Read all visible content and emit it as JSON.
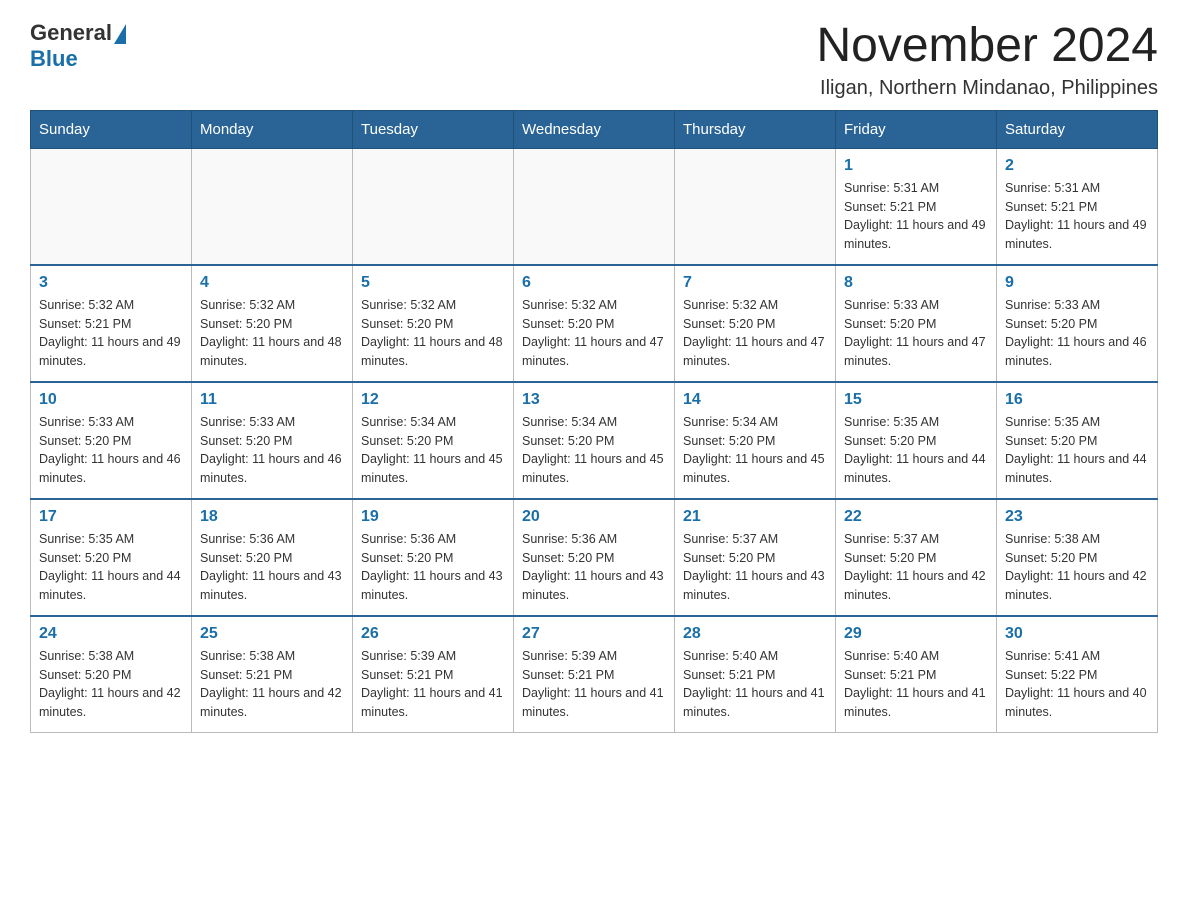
{
  "header": {
    "logo_general": "General",
    "logo_blue": "Blue",
    "month_title": "November 2024",
    "location": "Iligan, Northern Mindanao, Philippines"
  },
  "weekdays": [
    "Sunday",
    "Monday",
    "Tuesday",
    "Wednesday",
    "Thursday",
    "Friday",
    "Saturday"
  ],
  "weeks": [
    [
      {
        "day": "",
        "info": ""
      },
      {
        "day": "",
        "info": ""
      },
      {
        "day": "",
        "info": ""
      },
      {
        "day": "",
        "info": ""
      },
      {
        "day": "",
        "info": ""
      },
      {
        "day": "1",
        "info": "Sunrise: 5:31 AM\nSunset: 5:21 PM\nDaylight: 11 hours and 49 minutes."
      },
      {
        "day": "2",
        "info": "Sunrise: 5:31 AM\nSunset: 5:21 PM\nDaylight: 11 hours and 49 minutes."
      }
    ],
    [
      {
        "day": "3",
        "info": "Sunrise: 5:32 AM\nSunset: 5:21 PM\nDaylight: 11 hours and 49 minutes."
      },
      {
        "day": "4",
        "info": "Sunrise: 5:32 AM\nSunset: 5:20 PM\nDaylight: 11 hours and 48 minutes."
      },
      {
        "day": "5",
        "info": "Sunrise: 5:32 AM\nSunset: 5:20 PM\nDaylight: 11 hours and 48 minutes."
      },
      {
        "day": "6",
        "info": "Sunrise: 5:32 AM\nSunset: 5:20 PM\nDaylight: 11 hours and 47 minutes."
      },
      {
        "day": "7",
        "info": "Sunrise: 5:32 AM\nSunset: 5:20 PM\nDaylight: 11 hours and 47 minutes."
      },
      {
        "day": "8",
        "info": "Sunrise: 5:33 AM\nSunset: 5:20 PM\nDaylight: 11 hours and 47 minutes."
      },
      {
        "day": "9",
        "info": "Sunrise: 5:33 AM\nSunset: 5:20 PM\nDaylight: 11 hours and 46 minutes."
      }
    ],
    [
      {
        "day": "10",
        "info": "Sunrise: 5:33 AM\nSunset: 5:20 PM\nDaylight: 11 hours and 46 minutes."
      },
      {
        "day": "11",
        "info": "Sunrise: 5:33 AM\nSunset: 5:20 PM\nDaylight: 11 hours and 46 minutes."
      },
      {
        "day": "12",
        "info": "Sunrise: 5:34 AM\nSunset: 5:20 PM\nDaylight: 11 hours and 45 minutes."
      },
      {
        "day": "13",
        "info": "Sunrise: 5:34 AM\nSunset: 5:20 PM\nDaylight: 11 hours and 45 minutes."
      },
      {
        "day": "14",
        "info": "Sunrise: 5:34 AM\nSunset: 5:20 PM\nDaylight: 11 hours and 45 minutes."
      },
      {
        "day": "15",
        "info": "Sunrise: 5:35 AM\nSunset: 5:20 PM\nDaylight: 11 hours and 44 minutes."
      },
      {
        "day": "16",
        "info": "Sunrise: 5:35 AM\nSunset: 5:20 PM\nDaylight: 11 hours and 44 minutes."
      }
    ],
    [
      {
        "day": "17",
        "info": "Sunrise: 5:35 AM\nSunset: 5:20 PM\nDaylight: 11 hours and 44 minutes."
      },
      {
        "day": "18",
        "info": "Sunrise: 5:36 AM\nSunset: 5:20 PM\nDaylight: 11 hours and 43 minutes."
      },
      {
        "day": "19",
        "info": "Sunrise: 5:36 AM\nSunset: 5:20 PM\nDaylight: 11 hours and 43 minutes."
      },
      {
        "day": "20",
        "info": "Sunrise: 5:36 AM\nSunset: 5:20 PM\nDaylight: 11 hours and 43 minutes."
      },
      {
        "day": "21",
        "info": "Sunrise: 5:37 AM\nSunset: 5:20 PM\nDaylight: 11 hours and 43 minutes."
      },
      {
        "day": "22",
        "info": "Sunrise: 5:37 AM\nSunset: 5:20 PM\nDaylight: 11 hours and 42 minutes."
      },
      {
        "day": "23",
        "info": "Sunrise: 5:38 AM\nSunset: 5:20 PM\nDaylight: 11 hours and 42 minutes."
      }
    ],
    [
      {
        "day": "24",
        "info": "Sunrise: 5:38 AM\nSunset: 5:20 PM\nDaylight: 11 hours and 42 minutes."
      },
      {
        "day": "25",
        "info": "Sunrise: 5:38 AM\nSunset: 5:21 PM\nDaylight: 11 hours and 42 minutes."
      },
      {
        "day": "26",
        "info": "Sunrise: 5:39 AM\nSunset: 5:21 PM\nDaylight: 11 hours and 41 minutes."
      },
      {
        "day": "27",
        "info": "Sunrise: 5:39 AM\nSunset: 5:21 PM\nDaylight: 11 hours and 41 minutes."
      },
      {
        "day": "28",
        "info": "Sunrise: 5:40 AM\nSunset: 5:21 PM\nDaylight: 11 hours and 41 minutes."
      },
      {
        "day": "29",
        "info": "Sunrise: 5:40 AM\nSunset: 5:21 PM\nDaylight: 11 hours and 41 minutes."
      },
      {
        "day": "30",
        "info": "Sunrise: 5:41 AM\nSunset: 5:22 PM\nDaylight: 11 hours and 40 minutes."
      }
    ]
  ]
}
